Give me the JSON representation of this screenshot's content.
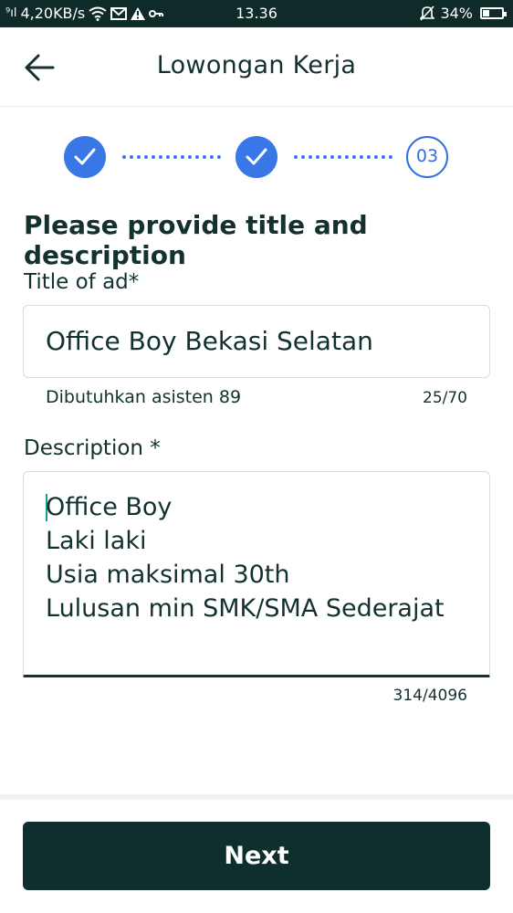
{
  "status_bar": {
    "signal": "⁹ıl",
    "speed": "4,20KB/s",
    "time": "13.36",
    "battery": "34%",
    "battery_level": 0.34,
    "icons": [
      "signal-icon",
      "wifi-icon",
      "mail-icon",
      "warning-icon",
      "key-icon",
      "mute-icon",
      "battery-icon"
    ]
  },
  "header": {
    "title": "Lowongan Kerja",
    "back_icon": "arrow-left-icon"
  },
  "stepper": {
    "steps": [
      {
        "state": "done",
        "icon": "check-icon"
      },
      {
        "state": "done",
        "icon": "check-icon"
      },
      {
        "state": "current",
        "label": "03"
      }
    ],
    "accent": "#3a77e6"
  },
  "form": {
    "heading": "Please provide title and description",
    "title_field": {
      "label": "Title of ad*",
      "value": "Office Boy Bekasi Selatan",
      "hint": "Dibutuhkan asisten 89",
      "counter": "25/70"
    },
    "description_field": {
      "label": "Description *",
      "lines": [
        "Office Boy",
        "Laki laki",
        "Usia maksimal 30th",
        "Lulusan min SMK/SMA Sederajat"
      ],
      "counter": "314/4096"
    }
  },
  "footer": {
    "next_label": "Next",
    "button_color": "#0e2f2d"
  }
}
